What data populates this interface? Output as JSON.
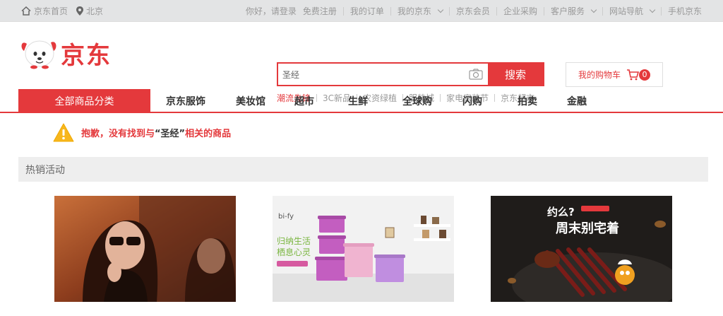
{
  "topbar": {
    "home_label": "京东首页",
    "location_label": "北京",
    "greeting": "你好，请登录",
    "register": "免费注册",
    "links": [
      "我的订单",
      "我的京东",
      "京东会员",
      "企业采购",
      "客户服务",
      "网站导航",
      "手机京东"
    ]
  },
  "header": {
    "brand": "京东",
    "search_value": "圣经",
    "search_button": "搜索",
    "cart_label": "我的购物车",
    "cart_count": "0",
    "hot_words": [
      "潮流先锋",
      "3C新品",
      "农资绿植",
      "服装城",
      "家电家装节",
      "京东超市"
    ]
  },
  "nav": {
    "all_label": "全部商品分类",
    "items": [
      "京东服饰",
      "美妆馆",
      "超市",
      "生鲜",
      "全球购",
      "闪购",
      "拍卖",
      "金融"
    ]
  },
  "notice": {
    "before": "抱歉，没有找到与",
    "keyword": "“圣经”",
    "after": "相关的商品"
  },
  "section": {
    "title": "热销活动"
  },
  "promos": [
    {
      "name": "promo-fashion"
    },
    {
      "name": "promo-storage",
      "brand_small": "bi-fy",
      "slogan1": "归纳生活",
      "slogan2": "栖息心灵"
    },
    {
      "name": "promo-bbq",
      "headline1": "约么?",
      "headline2": "周末别宅着"
    }
  ],
  "colors": {
    "accent": "#e4393c",
    "topbar_bg": "#e3e4e5"
  }
}
